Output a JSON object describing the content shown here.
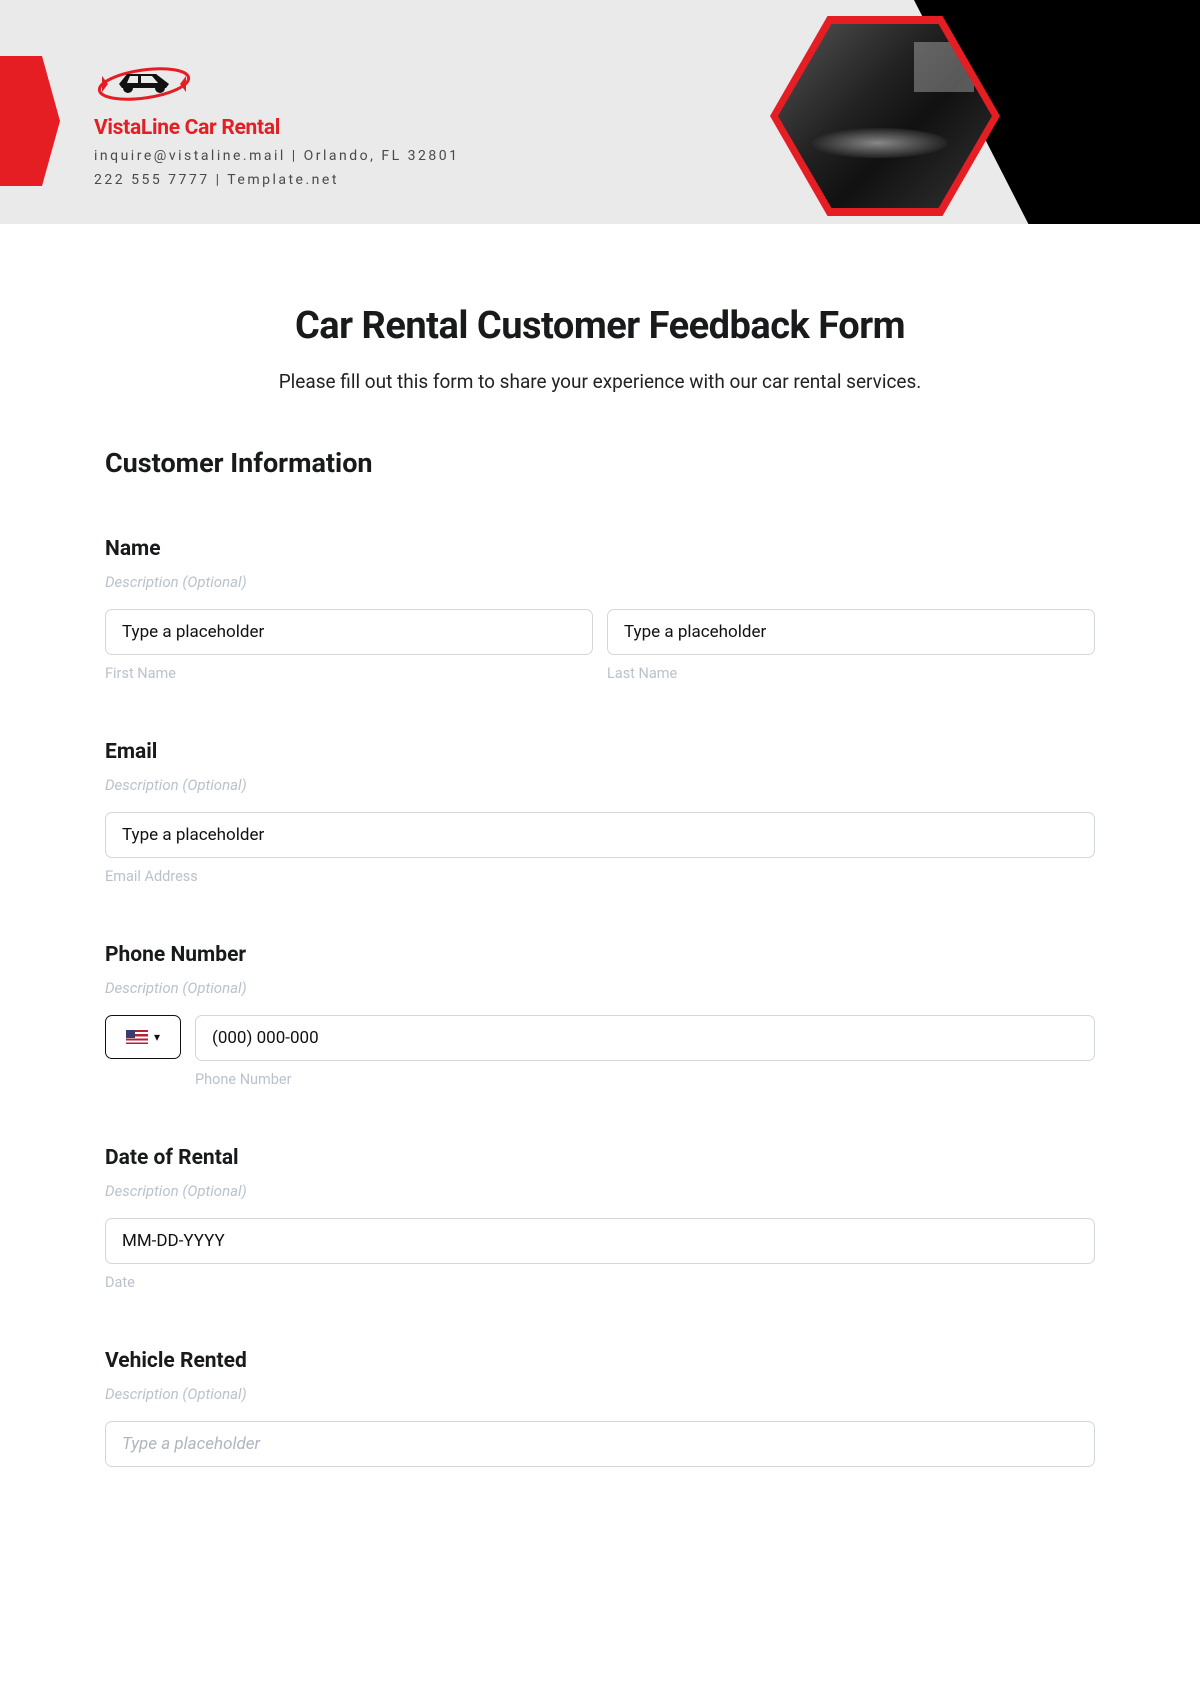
{
  "header": {
    "brand": "VistaLine Car Rental",
    "contact1": "inquire@vistaline.mail | Orlando, FL 32801",
    "contact2": "222 555 7777 | Template.net"
  },
  "form": {
    "title": "Car Rental Customer Feedback Form",
    "subtitle": "Please fill out this form to share your experience with our car rental services.",
    "section1": "Customer Information",
    "name": {
      "label": "Name",
      "desc": "Description (Optional)",
      "first_placeholder": "Type a placeholder",
      "first_sub": "First Name",
      "last_placeholder": "Type a placeholder",
      "last_sub": "Last Name"
    },
    "email": {
      "label": "Email",
      "desc": "Description (Optional)",
      "placeholder": "Type a placeholder",
      "sub": "Email Address"
    },
    "phone": {
      "label": "Phone Number",
      "desc": "Description (Optional)",
      "placeholder": "(000) 000-000",
      "sub": "Phone Number"
    },
    "date": {
      "label": "Date of Rental",
      "desc": "Description (Optional)",
      "placeholder": "MM-DD-YYYY",
      "sub": "Date"
    },
    "vehicle": {
      "label": "Vehicle Rented",
      "desc": "Description (Optional)",
      "placeholder": "Type a placeholder"
    }
  }
}
